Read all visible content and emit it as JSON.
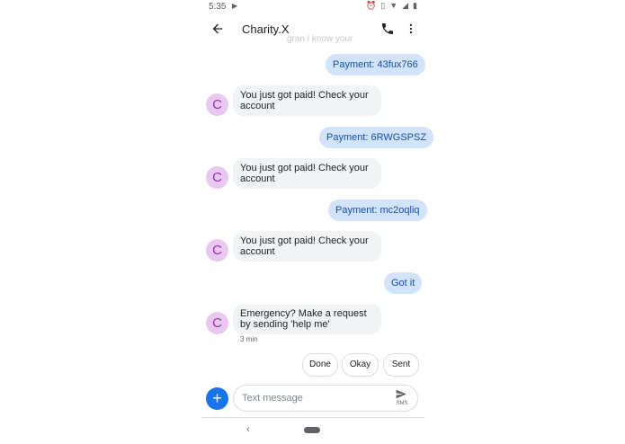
{
  "status": {
    "time": "5:35"
  },
  "header": {
    "title": "Charity.X",
    "ghost_text": "gran i know your"
  },
  "messages": [
    {
      "dir": "out",
      "text": "Payment: 43fux766"
    },
    {
      "dir": "in",
      "avatar": "C",
      "text": "You just got paid! Check your account"
    },
    {
      "dir": "out",
      "text": "Payment: 6RWGSPSZ"
    },
    {
      "dir": "in",
      "avatar": "C",
      "text": "You just got paid! Check your account"
    },
    {
      "dir": "out",
      "text": "Payment: mc2oqliq"
    },
    {
      "dir": "in",
      "avatar": "C",
      "text": "You just got paid! Check your account"
    },
    {
      "dir": "out",
      "text": "Got it"
    },
    {
      "dir": "in",
      "avatar": "C",
      "text": "Emergency? Make a request by sending 'help me'",
      "time": "3 min"
    }
  ],
  "suggestions": [
    "Done",
    "Okay",
    "Sent"
  ],
  "composer": {
    "placeholder": "Text message",
    "send_label": "SMS"
  },
  "colors": {
    "accent": "#1a73e8",
    "outgoing_bubble": "#d2e3fc",
    "incoming_bubble": "#f1f3f4",
    "avatar_bg": "#e8c7f0",
    "avatar_fg": "#9334a9"
  },
  "icons": {
    "back": "arrow-left-icon",
    "call": "phone-icon",
    "more": "more-vert-icon",
    "send": "send-icon",
    "add": "plus-icon"
  }
}
